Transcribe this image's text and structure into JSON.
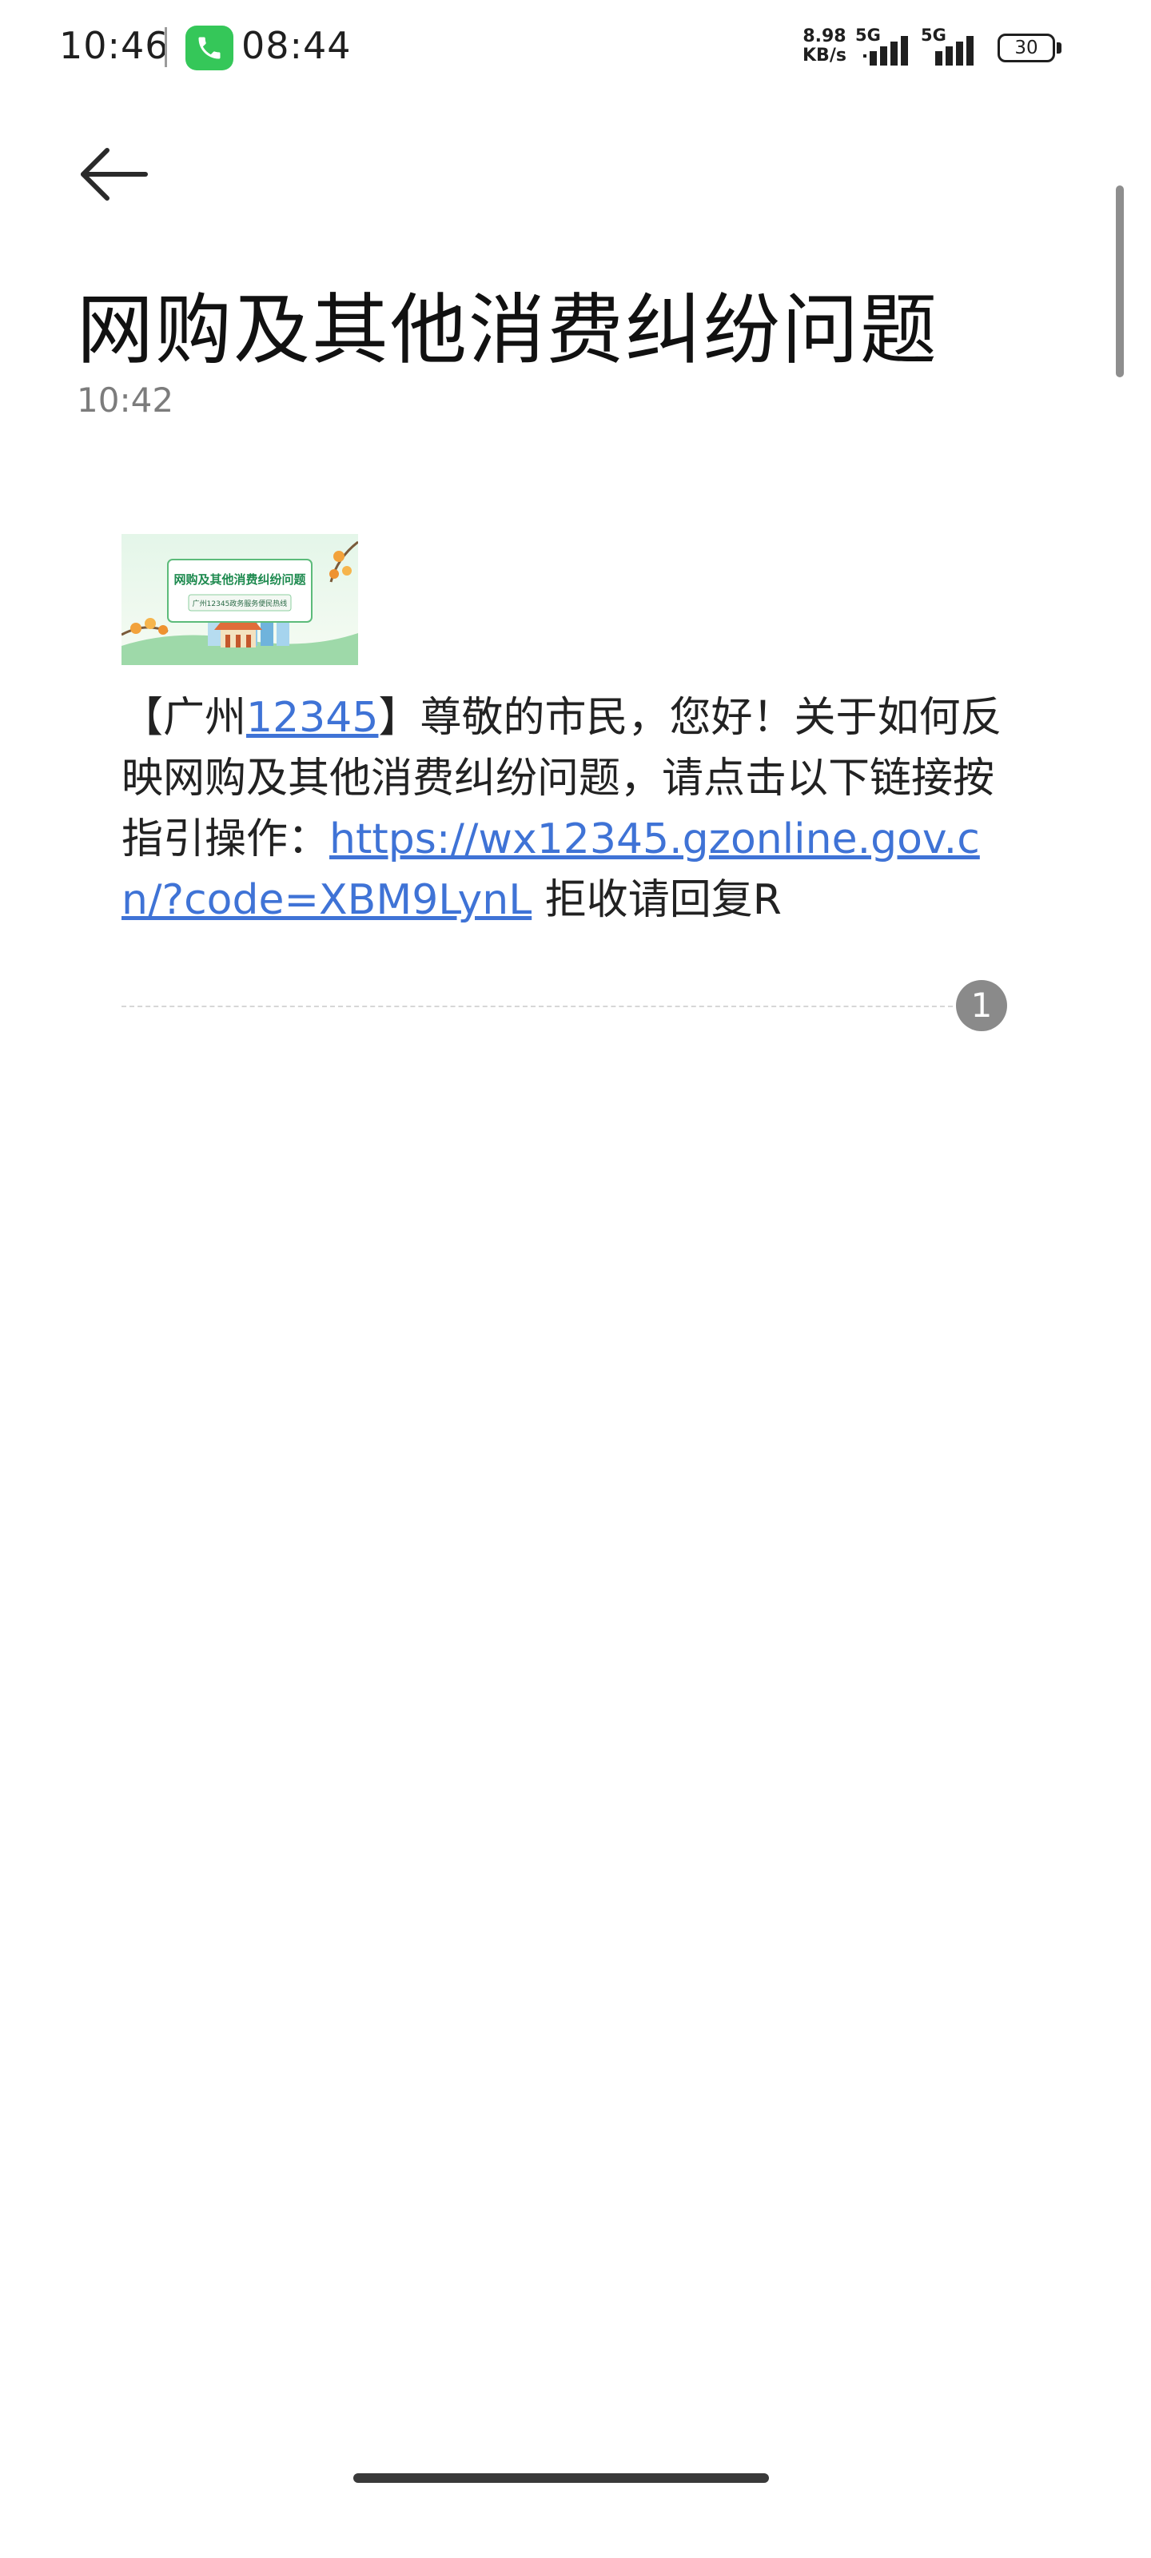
{
  "status_bar": {
    "time": "10:46",
    "call_time": "08:44",
    "net_speed_value": "8.98",
    "net_speed_unit": "KB/s",
    "network_1": "5G",
    "network_2": "5G",
    "battery_level": "30",
    "call_pill_color": "#35c759",
    "icons": [
      "phone-icon",
      "signal-icon",
      "battery-icon"
    ]
  },
  "header": {
    "back_icon": "back-arrow-icon",
    "title": "网购及其他消费纠纷问题",
    "time": "10:42"
  },
  "message": {
    "image_banner_title": "网购及其他消费纠纷问题",
    "image_banner_subtitle": "广州12345政务服务便民热线",
    "text_open_bracket": "【广州",
    "text_number_link": "12345",
    "text_body": "】尊敬的市民，您好！关于如何反映网购及其他消费纠纷问题，请点击以下链接按指引操作：",
    "url_link": "https://wx12345.gzonline.gov.cn/?code=XBM9LynL",
    "text_tail": " 拒收请回复R",
    "link_color": "#3f73d6",
    "message_count": "1"
  }
}
